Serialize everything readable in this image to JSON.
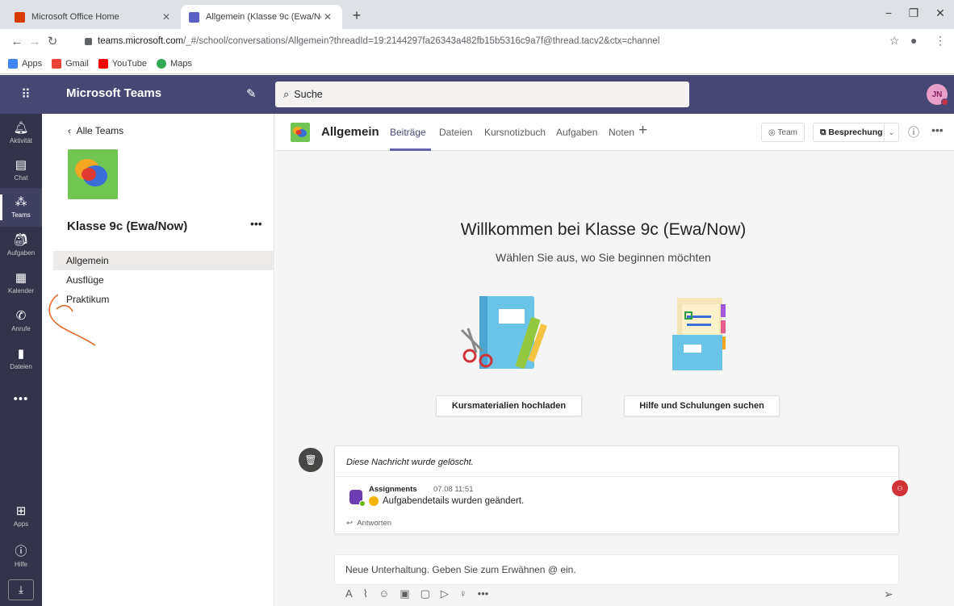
{
  "browser": {
    "tabs": [
      {
        "title": "Microsoft Office Home",
        "close": "✕"
      },
      {
        "title": "Allgemein (Klasse 9c (Ewa/Now))",
        "close": "✕"
      }
    ],
    "new_tab": "+",
    "url_host": "teams.microsoft.com",
    "url_path": "/_#/school/conversations/Allgemein?threadId=19:2144297fa26343a482fb15b5316c9a7f@thread.tacv2&ctx=channel",
    "bookmarks": [
      "Apps",
      "Gmail",
      "YouTube",
      "Maps"
    ]
  },
  "header": {
    "app_title": "Microsoft Teams",
    "search_placeholder": "Suche",
    "avatar_initials": "JN"
  },
  "rail": {
    "items": [
      "Aktivität",
      "Chat",
      "Teams",
      "Aufgaben",
      "Kalender",
      "Anrufe",
      "Dateien"
    ],
    "more": "•••",
    "bottom": [
      "Apps",
      "Hilfe"
    ]
  },
  "team_panel": {
    "back": "Alle Teams",
    "team_name": "Klasse 9c (Ewa/Now)",
    "more": "•••",
    "channels": [
      "Allgemein",
      "Ausflüge",
      "Praktikum"
    ],
    "selected_channel": "Allgemein"
  },
  "channel": {
    "title": "Allgemein",
    "tabs": [
      "Beiträge",
      "Dateien",
      "Kursnotizbuch",
      "Aufgaben",
      "Noten"
    ],
    "active_tab": "Beiträge",
    "team_button": "Team",
    "meet_button": "Besprechung"
  },
  "welcome": {
    "title": "Willkommen bei Klasse 9c (Ewa/Now)",
    "subtitle": "Wählen Sie aus, wo Sie beginnen möchten",
    "button_upload": "Kursmaterialien hochladen",
    "button_help": "Hilfe und Schulungen suchen"
  },
  "message": {
    "deleted_text": "Diese Nachricht wurde gelöscht.",
    "reply_author": "Assignments",
    "reply_time": "07.08 11:51",
    "reply_text": "Aufgabendetails wurden geändert.",
    "reply_action": "Antworten"
  },
  "compose": {
    "placeholder": "Neue Unterhaltung. Geben Sie zum Erwähnen @ ein."
  },
  "colors": {
    "teams_purple": "#464775",
    "rail": "#33344a",
    "accent": "#6264a7",
    "team_logo_green": "#71c552",
    "annotation_orange": "#e2672a"
  }
}
